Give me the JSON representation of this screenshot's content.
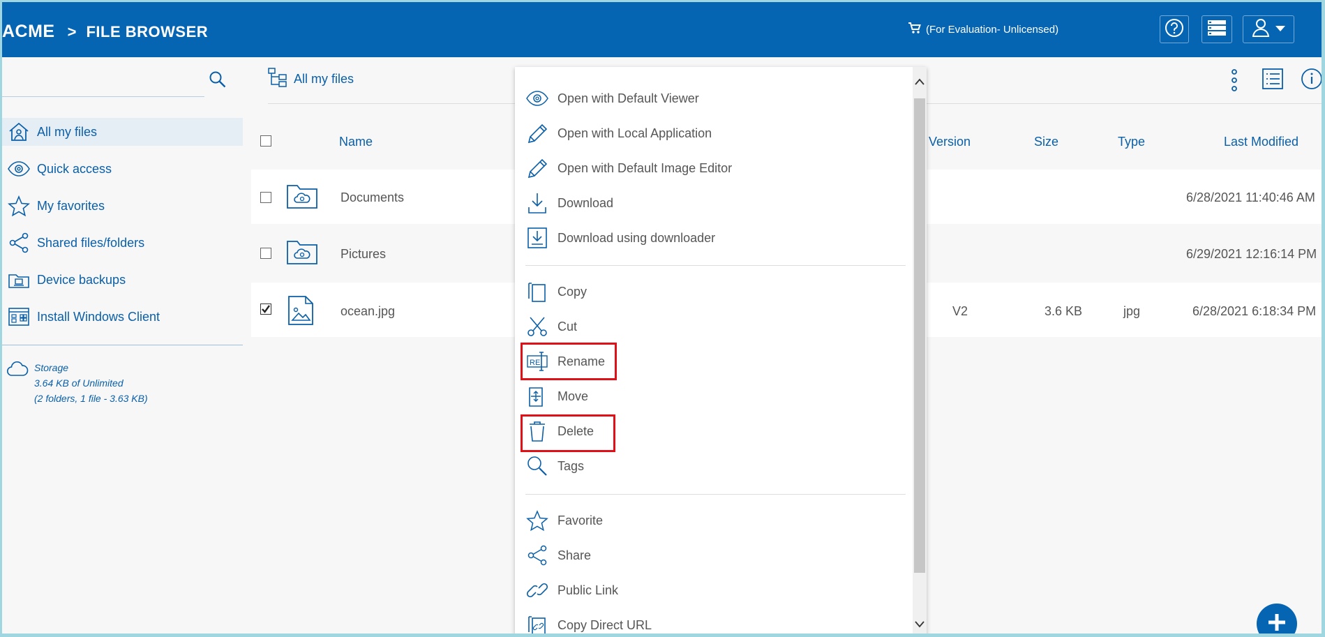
{
  "header": {
    "brand": "ACME",
    "separator": ">",
    "title": "FILE BROWSER",
    "license": "(For Evaluation- Unlicensed)"
  },
  "sidebar": {
    "search_placeholder": "",
    "items": [
      {
        "label": "All my files",
        "icon": "home-user-icon",
        "active": true
      },
      {
        "label": "Quick access",
        "icon": "eye-icon"
      },
      {
        "label": "My favorites",
        "icon": "star-icon"
      },
      {
        "label": "Shared files/folders",
        "icon": "share-icon"
      },
      {
        "label": "Device backups",
        "icon": "backup-icon"
      },
      {
        "label": "Install Windows Client",
        "icon": "windows-client-icon"
      }
    ],
    "storage": {
      "title": "Storage",
      "used": "3.64 KB of Unlimited",
      "summary": "(2 folders, 1 file - 3.63 KB)"
    }
  },
  "toolbar": {
    "location": "All my files"
  },
  "table": {
    "columns": [
      "Name",
      "Version",
      "Size",
      "Type",
      "Last Modified"
    ],
    "rows": [
      {
        "name": "Documents",
        "version": "",
        "size": "",
        "type": "",
        "modified": "6/28/2021 11:40:46 AM",
        "kind": "folder",
        "checked": false
      },
      {
        "name": "Pictures",
        "version": "",
        "size": "",
        "type": "",
        "modified": "6/29/2021 12:16:14 PM",
        "kind": "folder",
        "checked": false
      },
      {
        "name": "ocean.jpg",
        "version": "V2",
        "size": "3.6 KB",
        "type": "jpg",
        "modified": "6/28/2021 6:18:34 PM",
        "kind": "image",
        "checked": true
      }
    ]
  },
  "context_menu": {
    "items": [
      "Open with Default Viewer",
      "Open with Local Application",
      "Open with Default Image Editor",
      "Download",
      "Download using downloader",
      "Copy",
      "Cut",
      "Rename",
      "Move",
      "Delete",
      "Tags",
      "Favorite",
      "Share",
      "Public Link",
      "Copy Direct URL"
    ],
    "highlighted": [
      "Rename",
      "Delete"
    ],
    "highlight_color": "#e01018"
  },
  "colors": {
    "header_bg": "#0565b3",
    "link": "#0a5fa8"
  }
}
